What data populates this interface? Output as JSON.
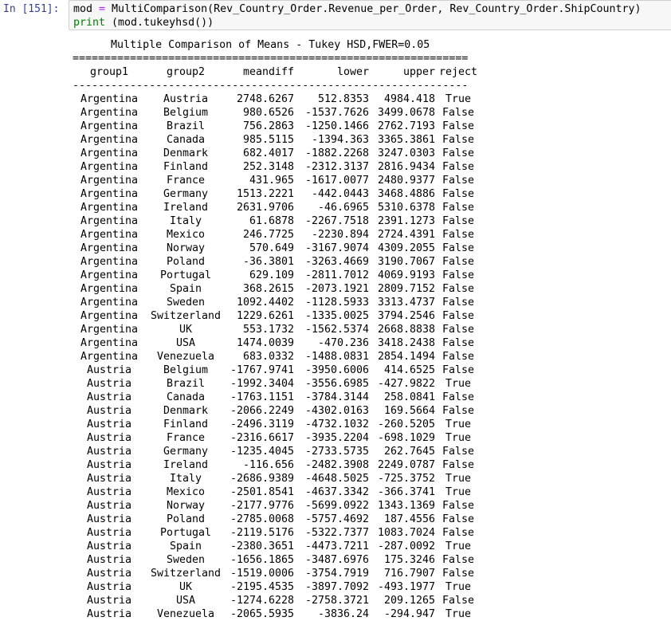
{
  "cell": {
    "prompt": "In [151]:",
    "code_lines": [
      "mod = MultiComparison(Rev_Country_Order.Revenue_per_Order, Rev_Country_Order.ShipCountry)",
      "print (mod.tukeyhsd())"
    ]
  },
  "output": {
    "title": "Multiple Comparison of Means - Tukey HSD,FWER=0.05",
    "rule_double": "==============================================================",
    "rule_single": "--------------------------------------------------------------",
    "headers": [
      "group1",
      "group2",
      "meandiff",
      "lower",
      "upper",
      "reject"
    ],
    "rows": [
      [
        "Argentina",
        "Austria",
        "2748.6267",
        "512.8353",
        "4984.418",
        "True"
      ],
      [
        "Argentina",
        "Belgium",
        "980.6526",
        "-1537.7626",
        "3499.0678",
        "False"
      ],
      [
        "Argentina",
        "Brazil",
        "756.2863",
        "-1250.1466",
        "2762.7193",
        "False"
      ],
      [
        "Argentina",
        "Canada",
        "985.5115",
        "-1394.363",
        "3365.3861",
        "False"
      ],
      [
        "Argentina",
        "Denmark",
        "682.4017",
        "-1882.2268",
        "3247.0303",
        "False"
      ],
      [
        "Argentina",
        "Finland",
        "252.3148",
        "-2312.3137",
        "2816.9434",
        "False"
      ],
      [
        "Argentina",
        "France",
        "431.965",
        "-1617.0077",
        "2480.9377",
        "False"
      ],
      [
        "Argentina",
        "Germany",
        "1513.2221",
        "-442.0443",
        "3468.4886",
        "False"
      ],
      [
        "Argentina",
        "Ireland",
        "2631.9706",
        "-46.6965",
        "5310.6378",
        "False"
      ],
      [
        "Argentina",
        "Italy",
        "61.6878",
        "-2267.7518",
        "2391.1273",
        "False"
      ],
      [
        "Argentina",
        "Mexico",
        "246.7725",
        "-2230.894",
        "2724.4391",
        "False"
      ],
      [
        "Argentina",
        "Norway",
        "570.649",
        "-3167.9074",
        "4309.2055",
        "False"
      ],
      [
        "Argentina",
        "Poland",
        "-36.3801",
        "-3263.4669",
        "3190.7067",
        "False"
      ],
      [
        "Argentina",
        "Portugal",
        "629.109",
        "-2811.7012",
        "4069.9193",
        "False"
      ],
      [
        "Argentina",
        "Spain",
        "368.2615",
        "-2073.1921",
        "2809.7152",
        "False"
      ],
      [
        "Argentina",
        "Sweden",
        "1092.4402",
        "-1128.5933",
        "3313.4737",
        "False"
      ],
      [
        "Argentina",
        "Switzerland",
        "1229.6261",
        "-1335.0025",
        "3794.2546",
        "False"
      ],
      [
        "Argentina",
        "UK",
        "553.1732",
        "-1562.5374",
        "2668.8838",
        "False"
      ],
      [
        "Argentina",
        "USA",
        "1474.0039",
        "-470.236",
        "3418.2438",
        "False"
      ],
      [
        "Argentina",
        "Venezuela",
        "683.0332",
        "-1488.0831",
        "2854.1494",
        "False"
      ],
      [
        "Austria",
        "Belgium",
        "-1767.9741",
        "-3950.6006",
        "414.6525",
        "False"
      ],
      [
        "Austria",
        "Brazil",
        "-1992.3404",
        "-3556.6985",
        "-427.9822",
        "True"
      ],
      [
        "Austria",
        "Canada",
        "-1763.1151",
        "-3784.3144",
        "258.0841",
        "False"
      ],
      [
        "Austria",
        "Denmark",
        "-2066.2249",
        "-4302.0163",
        "169.5664",
        "False"
      ],
      [
        "Austria",
        "Finland",
        "-2496.3119",
        "-4732.1032",
        "-260.5205",
        "True"
      ],
      [
        "Austria",
        "France",
        "-2316.6617",
        "-3935.2204",
        "-698.1029",
        "True"
      ],
      [
        "Austria",
        "Germany",
        "-1235.4045",
        "-2733.5735",
        "262.7645",
        "False"
      ],
      [
        "Austria",
        "Ireland",
        "-116.656",
        "-2482.3908",
        "2249.0787",
        "False"
      ],
      [
        "Austria",
        "Italy",
        "-2686.9389",
        "-4648.5025",
        "-725.3752",
        "True"
      ],
      [
        "Austria",
        "Mexico",
        "-2501.8541",
        "-4637.3342",
        "-366.3741",
        "True"
      ],
      [
        "Austria",
        "Norway",
        "-2177.9776",
        "-5699.0922",
        "1343.1369",
        "False"
      ],
      [
        "Austria",
        "Poland",
        "-2785.0068",
        "-5757.4692",
        "187.4556",
        "False"
      ],
      [
        "Austria",
        "Portugal",
        "-2119.5176",
        "-5322.7377",
        "1083.7024",
        "False"
      ],
      [
        "Austria",
        "Spain",
        "-2380.3651",
        "-4473.7211",
        "-287.0092",
        "True"
      ],
      [
        "Austria",
        "Sweden",
        "-1656.1865",
        "-3487.6976",
        "175.3246",
        "False"
      ],
      [
        "Austria",
        "Switzerland",
        "-1519.0006",
        "-3754.7919",
        "716.7907",
        "False"
      ],
      [
        "Austria",
        "UK",
        "-2195.4535",
        "-3897.7092",
        "-493.1977",
        "True"
      ],
      [
        "Austria",
        "USA",
        "-1274.6228",
        "-2758.3721",
        "209.1265",
        "False"
      ],
      [
        "Austria",
        "Venezuela",
        "-2065.5935",
        "-3836.24",
        "-294.947",
        "True"
      ]
    ]
  }
}
